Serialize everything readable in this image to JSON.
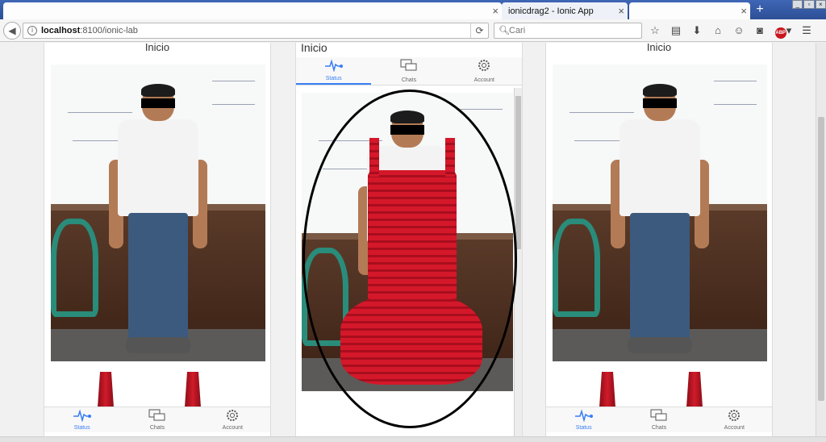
{
  "browser": {
    "tabs": [
      {
        "label": "",
        "redacted": true
      },
      {
        "label": "ionicdrag2 - Ionic App",
        "active": true
      },
      {
        "label": "",
        "redacted": true
      }
    ],
    "new_tab": "+",
    "url_host": "localhost",
    "url_path": ":8100/ionic-lab",
    "search_placeholder": "Cari",
    "icons": [
      "back-icon",
      "info-icon",
      "reload-icon",
      "search-icon",
      "star-icon",
      "reading-list-icon",
      "download-icon",
      "home-icon",
      "smiley-icon",
      "pocket-icon",
      "adblock-icon",
      "menu-icon"
    ],
    "adblock_label": "ABP"
  },
  "app": {
    "title": "Inicio",
    "tabs": [
      {
        "label": "Status",
        "icon": "pulse-icon",
        "active": true
      },
      {
        "label": "Chats",
        "icon": "chat-bubbles-icon",
        "active": false
      },
      {
        "label": "Account",
        "icon": "gear-icon",
        "active": false
      }
    ],
    "colors": {
      "accent": "#387ef5",
      "dress_red": "#d4182a"
    }
  },
  "devices": [
    {
      "name": "left",
      "tab_position": "bottom"
    },
    {
      "name": "middle",
      "tab_position": "top"
    },
    {
      "name": "right",
      "tab_position": "bottom"
    }
  ]
}
